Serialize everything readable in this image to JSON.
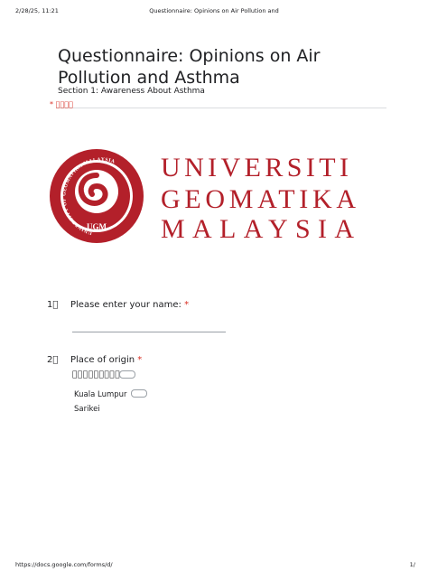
{
  "print_header": {
    "datetime": "2/28/25, 11:21",
    "page_title": "Questionnaire: Opinions on Air Pollution and"
  },
  "form": {
    "title": "Questionnaire: Opinions on Air Pollution and Asthma",
    "section": "Section 1: Awareness About Asthma",
    "required_note": "* 􏰀􏰁􏰂􏰃"
  },
  "logo": {
    "line1": "UNIVERSITI",
    "line2": "GEOMATIKA",
    "line3": "MALAYSIA",
    "seal_ring_text": "UNIVERSITY OF GEOMATIKA MALAYSIA",
    "seal_abbr": "UGM",
    "brand_color": "#b3202a"
  },
  "questions": [
    {
      "number": "1􏰄",
      "label": "Please enter your name: ",
      "required_mark": "*"
    },
    {
      "number": "2􏰄",
      "label": "Place of origin ",
      "required_mark": "*",
      "garbled_text": "􏰅􏰆􏰇􏰈􏰉􏰊􏰋􏰌􏰍",
      "options": [
        "Kuala Lumpur",
        "Sarikei"
      ]
    }
  ],
  "footer": {
    "url": "https://docs.google.com/forms/d/",
    "page": "1/"
  }
}
